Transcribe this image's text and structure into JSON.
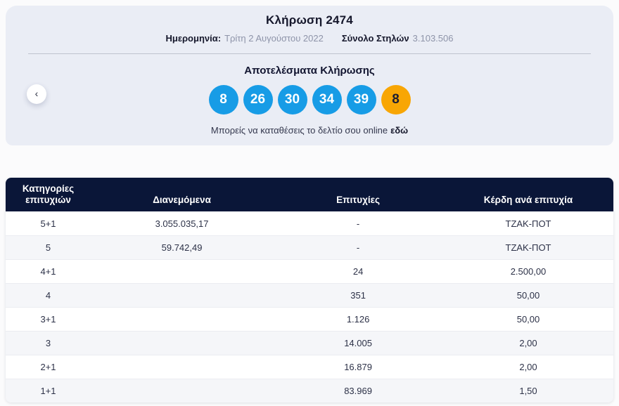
{
  "hero": {
    "title": "Κλήρωση 2474",
    "date_label": "Ημερομηνία:",
    "date_value": "Τρίτη 2 Αυγούστου 2022",
    "columns_label": "Σύνολο Στηλών",
    "columns_value": "3.103.506",
    "results_title": "Αποτελέσματα Κλήρωσης",
    "numbers": [
      {
        "value": "8",
        "type": "main"
      },
      {
        "value": "26",
        "type": "main"
      },
      {
        "value": "30",
        "type": "main"
      },
      {
        "value": "34",
        "type": "main"
      },
      {
        "value": "39",
        "type": "main"
      },
      {
        "value": "8",
        "type": "joker"
      }
    ],
    "caption_text": "Μπορείς να καταθέσεις το δελτίο σου online",
    "caption_link": "εδώ",
    "prev_icon": "‹"
  },
  "colors": {
    "hero_bg": "#eaedf5",
    "main_ball": "#179ce6",
    "joker_ball": "#f8a604",
    "table_header_bg": "#0a1638",
    "alt_row_bg": "#f5f6f9"
  },
  "table": {
    "headers": [
      "Κατηγορίες επιτυχιών",
      "Διανεμόμενα",
      "Επιτυχίες",
      "Κέρδη ανά επιτυχία"
    ],
    "rows": [
      [
        "5+1",
        "3.055.035,17",
        "-",
        "ΤΖΑΚ-ΠΟΤ"
      ],
      [
        "5",
        "59.742,49",
        "-",
        "ΤΖΑΚ-ΠΟΤ"
      ],
      [
        "4+1",
        "",
        "24",
        "2.500,00"
      ],
      [
        "4",
        "",
        "351",
        "50,00"
      ],
      [
        "3+1",
        "",
        "1.126",
        "50,00"
      ],
      [
        "3",
        "",
        "14.005",
        "2,00"
      ],
      [
        "2+1",
        "",
        "16.879",
        "2,00"
      ],
      [
        "1+1",
        "",
        "83.969",
        "1,50"
      ]
    ]
  }
}
